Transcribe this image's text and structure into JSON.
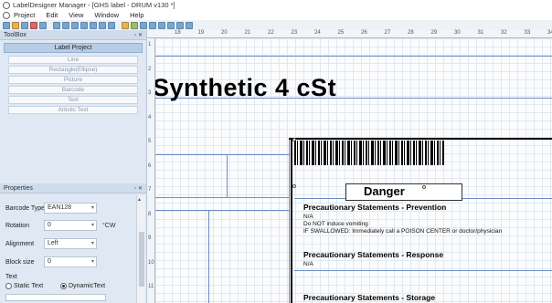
{
  "window": {
    "title": "LabelDesigner Manager - [GHS label - DRUM v130 *]"
  },
  "menu": {
    "items": [
      "Project",
      "Edit",
      "View",
      "Window",
      "Help"
    ]
  },
  "toolbox": {
    "title": "ToolBox",
    "section": "Label Project",
    "items": [
      "Line",
      "Rectangle(Ellipse)",
      "Picture",
      "Barcode",
      "Text",
      "Artistic Text"
    ]
  },
  "properties": {
    "title": "Properties",
    "barcode_type_label": "Barcode Type",
    "barcode_type_value": "EAN128",
    "rotation_label": "Rotation",
    "rotation_value": "0",
    "rotation_unit": "°CW",
    "alignment_label": "Alignment",
    "alignment_value": "Left",
    "block_size_label": "Block size",
    "block_size_value": "0",
    "text_label": "Text",
    "static_text_label": "Static Text",
    "dynamic_text_label": "DynamicText",
    "dynamic_text_selected": true
  },
  "ruler": {
    "h": [
      "18",
      "19",
      "20",
      "21",
      "22",
      "23",
      "24",
      "25",
      "26",
      "27",
      "28",
      "29",
      "30",
      "31",
      "32",
      "33",
      "34"
    ],
    "v": [
      "1",
      "2",
      "3",
      "4",
      "5",
      "6",
      "7",
      "8",
      "9",
      "10",
      "11"
    ]
  },
  "label": {
    "product_name": "Synthetic 4 cSt",
    "signal_word": "Danger",
    "sections": [
      {
        "title": "Precautionary Statements - Prevention",
        "lines": [
          "N/A",
          "Do NOT induce vomiting",
          "IF SWALLOWED: Immediately call a POISON CENTER or doctor/physician"
        ]
      },
      {
        "title": "Precautionary Statements - Response",
        "lines": [
          "N/A"
        ]
      },
      {
        "title": "Precautionary Statements - Storage",
        "lines": []
      }
    ]
  },
  "colors": {
    "panel_bg": "#dfe8f3",
    "ruler_bg": "#f1f4f8",
    "grid": "#e3e8ee"
  }
}
